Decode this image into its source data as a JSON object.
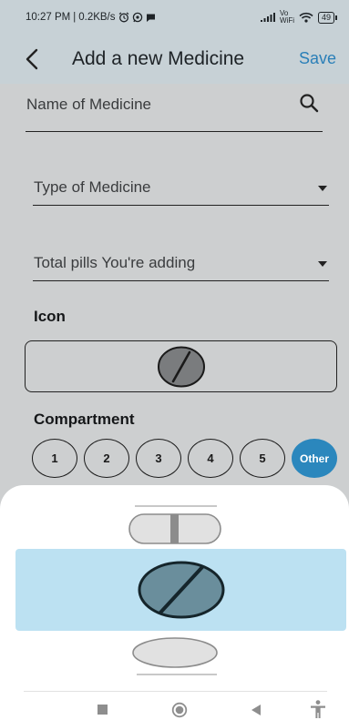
{
  "status_bar": {
    "time": "10:27 PM",
    "separator": "|",
    "speed": "0.2KB/s",
    "volte": "Vo",
    "wifi_label": "WiFi",
    "battery": "49"
  },
  "app_bar": {
    "title": "Add a new Medicine",
    "save_label": "Save"
  },
  "form": {
    "name_placeholder": "Name of Medicine",
    "type_placeholder": "Type of Medicine",
    "pills_placeholder": "Total pills You're adding",
    "icon_label": "Icon",
    "compartment_label": "Compartment",
    "compartments": [
      "1",
      "2",
      "3",
      "4",
      "5",
      "Other"
    ],
    "selected_compartment": "Other"
  },
  "icon_picker": {
    "options": [
      "capsule-icon",
      "round-tablet-icon",
      "oval-tablet-icon"
    ],
    "selected": "round-tablet-icon"
  },
  "colors": {
    "accent": "#2b87bd",
    "app_bar": "#c7d1d6",
    "selection": "#bce1f2",
    "pill_fill": "#6a8e9c"
  }
}
